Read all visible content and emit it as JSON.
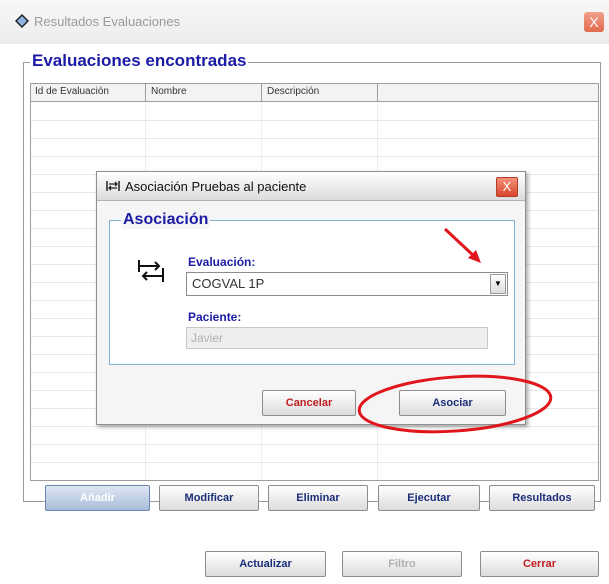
{
  "window": {
    "title": "Resultados Evaluaciones",
    "close_label": "X"
  },
  "group": {
    "legend": "Evaluaciones encontradas"
  },
  "grid": {
    "columns": [
      "Id de Evaluación",
      "Nombre",
      "Descripción"
    ]
  },
  "actions": {
    "add": "Añadir",
    "modify": "Modificar",
    "delete": "Eliminar",
    "execute": "Ejecutar",
    "results": "Resultados"
  },
  "footer": {
    "refresh": "Actualizar",
    "filter": "Filtro",
    "close": "Cerrar"
  },
  "dialog": {
    "title": "Asociación Pruebas al paciente",
    "close_label": "X",
    "group_legend": "Asociación",
    "evaluation_label": "Evaluación:",
    "evaluation_value": "COGVAL 1P",
    "patient_label": "Paciente:",
    "patient_value": "Javier",
    "cancel": "Cancelar",
    "associate": "Asociar"
  },
  "colors": {
    "accent_blue": "#1b1ba5",
    "cancel_red": "#c01e1e",
    "annotation_red": "#e0161c"
  },
  "icons": [
    "app-diamond-icon",
    "close-icon",
    "association-arrows-icon",
    "dropdown-arrow-icon"
  ]
}
